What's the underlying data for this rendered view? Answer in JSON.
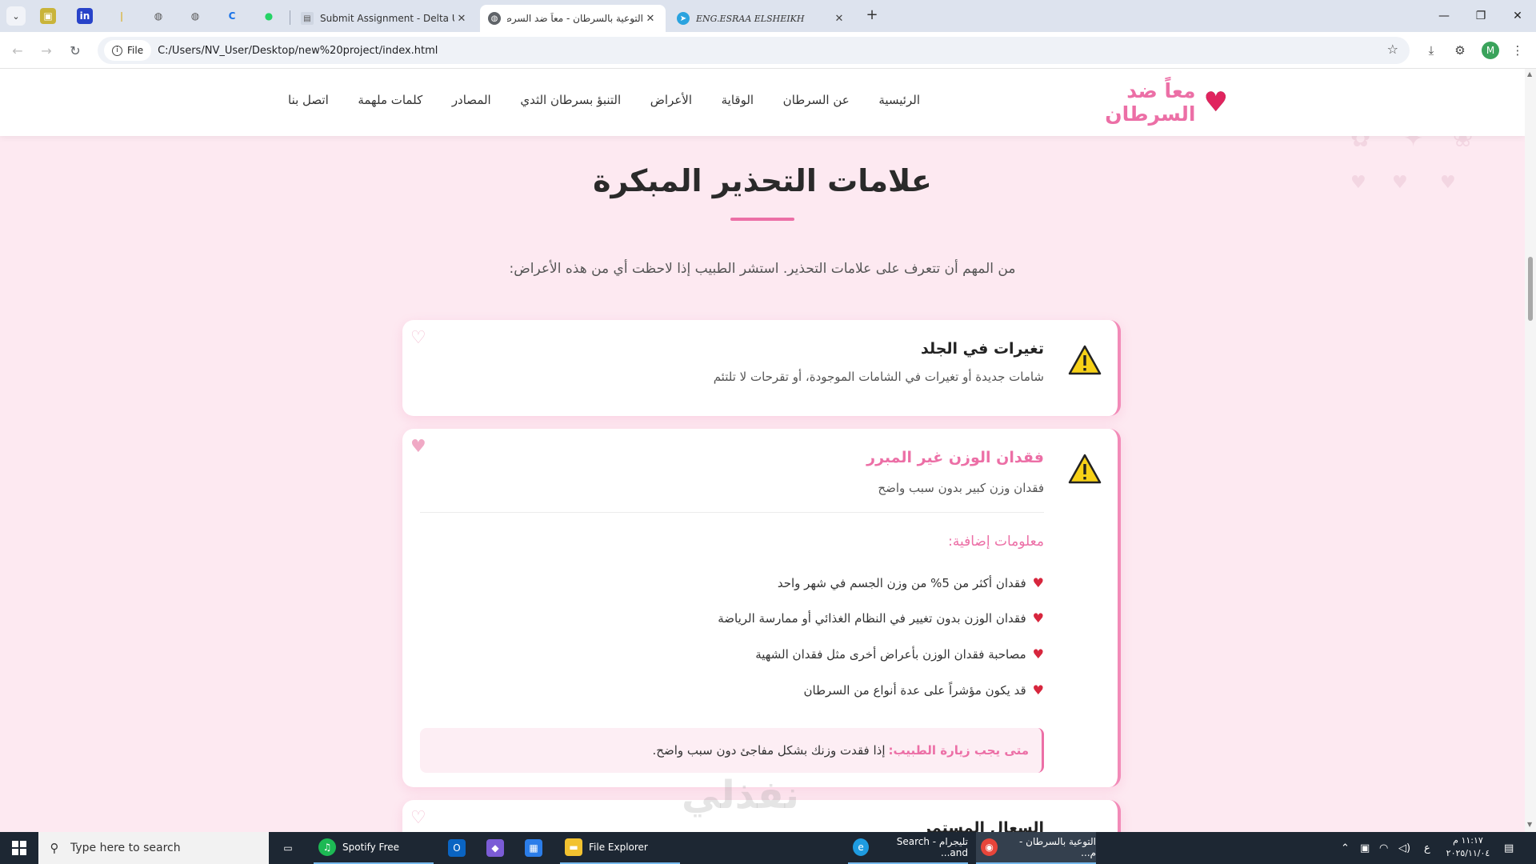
{
  "browser": {
    "tabs": [
      {
        "title": "Submit Assignment - Delta Univ"
      },
      {
        "title": "التوعية بالسرطان - معاً ضد السرطان"
      },
      {
        "title": "ENG.ESRAA ELSHEIKH"
      }
    ],
    "site_chip_label": "File",
    "url": "C:/Users/NV_User/Desktop/new%20project/index.html",
    "profile_initial": "M"
  },
  "site": {
    "logo_text": "معاً ضد السرطان",
    "nav": [
      "الرئيسية",
      "عن السرطان",
      "الوقاية",
      "الأعراض",
      "التنبؤ بسرطان الثدي",
      "المصادر",
      "كلمات ملهمة",
      "اتصل بنا"
    ]
  },
  "section": {
    "title": "علامات التحذير المبكرة",
    "subtitle": "من المهم أن تتعرف على علامات التحذير. استشر الطبيب إذا لاحظت أي من هذه الأعراض:"
  },
  "cards": [
    {
      "title": "تغيرات في الجلد",
      "description": "شامات جديدة أو تغيرات في الشامات الموجودة، أو تقرحات لا تلتئم"
    },
    {
      "title": "فقدان الوزن غير المبرر",
      "description": "فقدان وزن كبير بدون سبب واضح",
      "more_title": "معلومات إضافية:",
      "items": [
        "فقدان أكثر من 5% من وزن الجسم في شهر واحد",
        "فقدان الوزن بدون تغيير في النظام الغذائي أو ممارسة الرياضة",
        "مصاحبة فقدان الوزن بأعراض أخرى مثل فقدان الشهية",
        "قد يكون مؤشراً على عدة أنواع من السرطان"
      ],
      "doctor_label": "متى يجب زيارة الطبيب:",
      "doctor_text": "إذا فقدت وزنك بشكل مفاجئ دون سبب واضح."
    },
    {
      "title": "السعال المستمر"
    }
  ],
  "watermark": "نفذلي",
  "taskbar": {
    "search_placeholder": "Type here to search",
    "apps": [
      "Spotify Free",
      "File Explorer",
      "تليجرام - Search and...",
      "التوعية بالسرطان - م..."
    ],
    "tray_lang": "ع",
    "clock_time": "١١:١٧ م",
    "clock_date": "٢٠٢٥/١١/٠٤"
  },
  "colors": {
    "accent_pink": "#ec6fa6",
    "heart_red": "#d7263d",
    "page_bg": "#fde9f1"
  },
  "icons": [
    "warning-icon",
    "heart-icon",
    "star-icon",
    "download-icon",
    "windows-start-icon",
    "search-icon"
  ]
}
